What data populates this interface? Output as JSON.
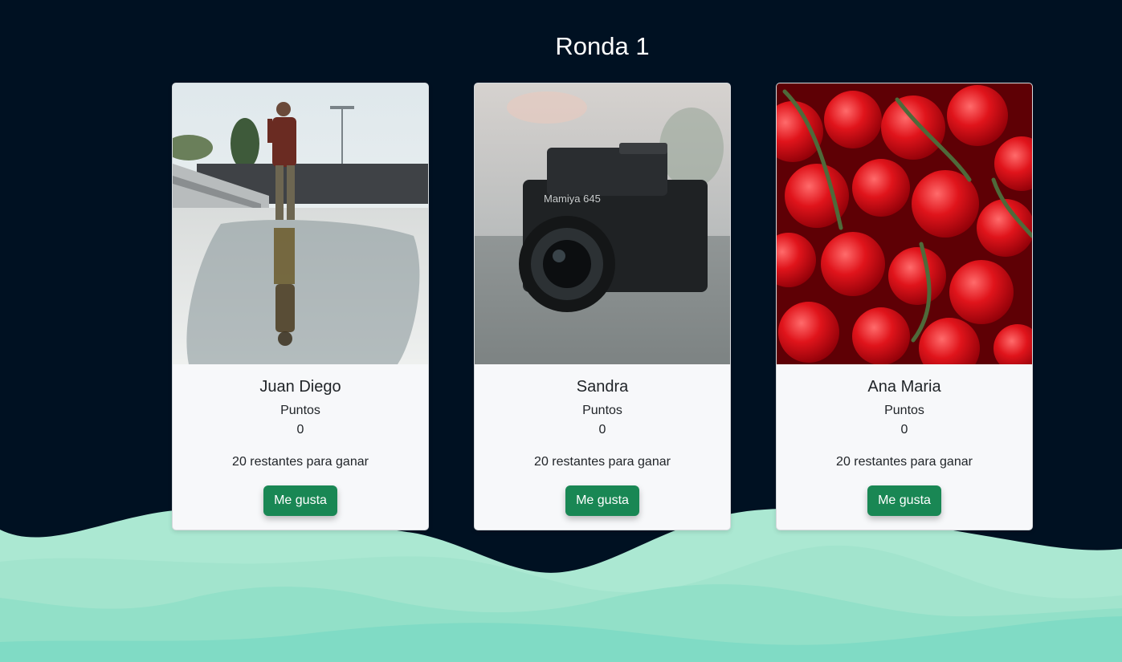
{
  "page": {
    "title": "Ronda 1"
  },
  "labels": {
    "points": "Puntos",
    "like_button": "Me gusta"
  },
  "players": [
    {
      "name": "Juan Diego",
      "points": "0",
      "remaining_text": "20 restantes para ganar",
      "photo": "man-standing-by-puddle-reflection"
    },
    {
      "name": "Sandra",
      "points": "0",
      "remaining_text": "20 restantes para ganar",
      "photo": "mamiya-645-camera"
    },
    {
      "name": "Ana Maria",
      "points": "0",
      "remaining_text": "20 restantes para ganar",
      "photo": "cherry-tomatoes-on-vine"
    }
  ],
  "colors": {
    "background": "#001122",
    "button": "#198754",
    "wave_light": "#a9e6cf",
    "wave_dark": "#7fdcc4"
  }
}
